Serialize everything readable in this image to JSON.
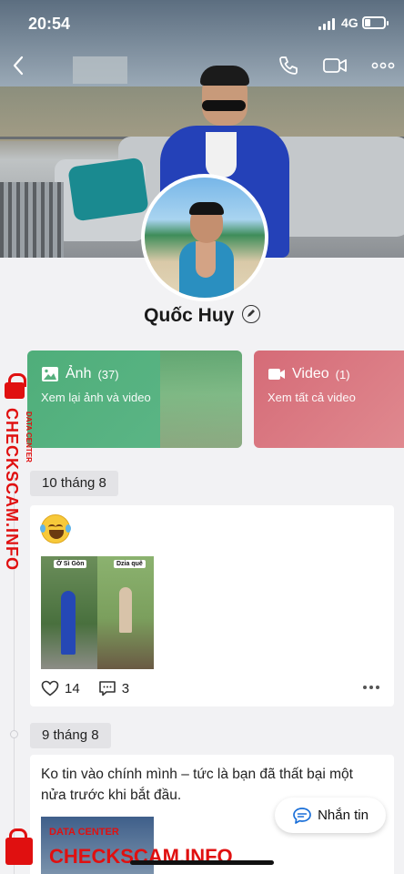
{
  "status_bar": {
    "time": "20:54",
    "network": "4G"
  },
  "profile": {
    "name": "Quốc Huy"
  },
  "media_cards": [
    {
      "title": "Ảnh",
      "count": "(37)",
      "subtitle": "Xem lại ảnh và video",
      "icon": "image-icon",
      "color": "#56b07e"
    },
    {
      "title": "Video",
      "count": "(1)",
      "subtitle": "Xem tất cả video",
      "icon": "video-icon",
      "color": "#d86f7b"
    }
  ],
  "timeline": [
    {
      "date": "10 tháng 8",
      "post": {
        "emoji": "laughing-tears-emoji",
        "image_tags": [
          "Ở Sì Gòn",
          "Dzia quê"
        ],
        "likes": "14",
        "comments": "3"
      }
    },
    {
      "date": "9 tháng 8",
      "post": {
        "text": "Ko tin vào chính mình – tức là bạn đã thất bại một nửa trước khi bắt đầu."
      }
    }
  ],
  "message_button": {
    "label": "Nhắn tin"
  },
  "watermark": {
    "small_label": "DATA CENTER",
    "brand": "CHECKSCAM.INFO",
    "color": "#e01010"
  }
}
